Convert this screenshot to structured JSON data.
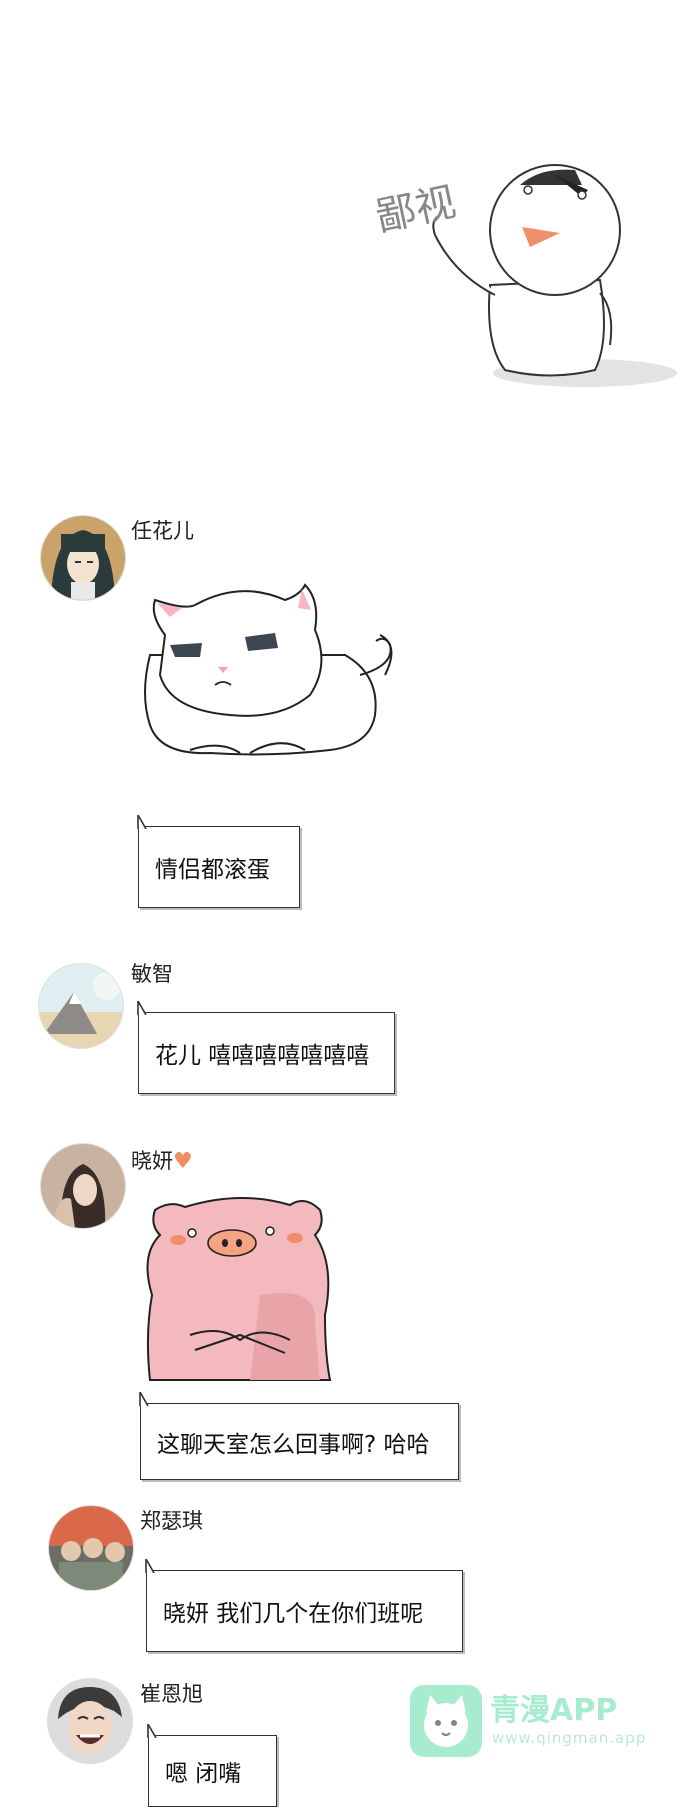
{
  "sticker_top": {
    "caption": "鄙视"
  },
  "messages": [
    {
      "sender": "任花儿",
      "text": "情侣都滚蛋"
    },
    {
      "sender": "敏智",
      "text": "花儿 嘻嘻嘻嘻嘻嘻嘻"
    },
    {
      "sender": "晓妍",
      "heart": "♥",
      "text": "这聊天室怎么回事啊? 哈哈"
    },
    {
      "sender": "郑瑟琪",
      "text": "晓妍 我们几个在你们班呢"
    },
    {
      "sender": "崔恩旭",
      "text": "嗯 闭嘴"
    }
  ],
  "watermark": {
    "title": "青漫APP",
    "url": "www.qingman.app"
  }
}
